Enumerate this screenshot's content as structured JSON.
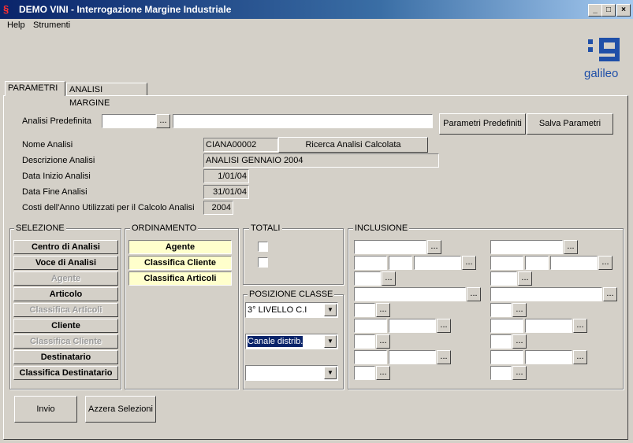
{
  "window": {
    "title": "DEMO VINI - Interrogazione Margine Industriale",
    "app_icon": "app-icon",
    "controls": {
      "minimize": "_",
      "maximize": "□",
      "close": "×"
    }
  },
  "menu": {
    "items": [
      "Help",
      "Strumenti"
    ]
  },
  "logo": {
    "text": "galileo",
    "color": "#1f4fa8"
  },
  "tabs": [
    {
      "label": "PARAMETRI",
      "active": true
    },
    {
      "label": "ANALISI MARGINE",
      "active": false
    }
  ],
  "params": {
    "analisi_predefinita_label": "Analisi Predefinita",
    "analisi_predefinita_value": "",
    "analisi_predefinita_desc": "",
    "dots": "...",
    "parametri_predefiniti": "Parametri Predefiniti",
    "salva_parametri": "Salva Parametri",
    "nome_analisi_label": "Nome Analisi",
    "nome_analisi_value": "CIANA00002",
    "ricerca_button": "Ricerca Analisi Calcolata",
    "descrizione_label": "Descrizione Analisi",
    "descrizione_value": "ANALISI GENNAIO 2004",
    "data_inizio_label": "Data Inizio Analisi",
    "data_inizio_value": "1/01/04",
    "data_fine_label": "Data Fine Analisi",
    "data_fine_value": "31/01/04",
    "costi_label": "Costi dell'Anno Utilizzati per il Calcolo Analisi",
    "costi_value": "2004"
  },
  "selezione": {
    "title": "SELEZIONE",
    "items": [
      {
        "label": "Centro di Analisi",
        "enabled": true
      },
      {
        "label": "Voce di Analisi",
        "enabled": true
      },
      {
        "label": "Agente",
        "enabled": false
      },
      {
        "label": "Articolo",
        "enabled": true
      },
      {
        "label": "Classifica Articoli",
        "enabled": false
      },
      {
        "label": "Cliente",
        "enabled": true
      },
      {
        "label": "Classifica Cliente",
        "enabled": false
      },
      {
        "label": "Destinatario",
        "enabled": true
      },
      {
        "label": "Classifica Destinatario",
        "enabled": true
      }
    ]
  },
  "ordinamento": {
    "title": "ORDINAMENTO",
    "items": [
      "Agente",
      "Classifica Cliente",
      "Classifica Articoli"
    ]
  },
  "totali": {
    "title": "TOTALI",
    "checked": [
      false,
      false
    ]
  },
  "posizione_classe": {
    "title": "POSIZIONE CLASSE",
    "combos": [
      "3° LIVELLO C.I",
      "Canale distrib.",
      ""
    ]
  },
  "inclusione": {
    "title": "INCLUSIONE"
  },
  "footer": {
    "invio": "Invio",
    "azzera": "Azzera Selezioni"
  }
}
